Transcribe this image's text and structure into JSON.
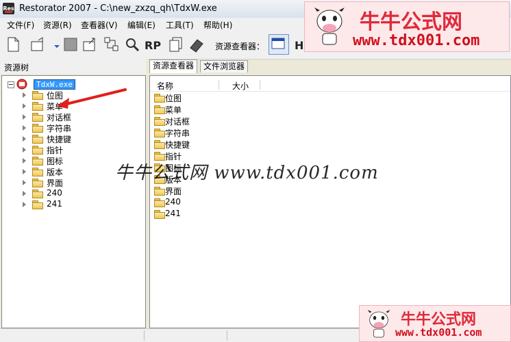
{
  "window": {
    "title": "Restorator 2007 - C:\\new_zxzq_qh\\TdxW.exe",
    "app_icon_text": "Res"
  },
  "menu": [
    {
      "label": "文件(F)"
    },
    {
      "label": "资源(R)"
    },
    {
      "label": "查看器(V)"
    },
    {
      "label": "编辑(E)"
    },
    {
      "label": "工具(T)"
    },
    {
      "label": "帮助(H)"
    }
  ],
  "toolbar": {
    "viewer_label": "资源查看器："
  },
  "left_panel": {
    "header": "资源树",
    "root": "TdxW.exe",
    "items": [
      "位图",
      "菜单",
      "对话框",
      "字符串",
      "快捷键",
      "指针",
      "图标",
      "版本",
      "界面",
      "240",
      "241"
    ]
  },
  "right_panel": {
    "tabs": [
      {
        "label": "资源查看器",
        "active": true
      },
      {
        "label": "文件浏览器",
        "active": false
      }
    ],
    "columns": [
      "名称",
      "大小"
    ],
    "items": [
      "位图",
      "菜单",
      "对话框",
      "字符串",
      "快捷键",
      "指针",
      "图标",
      "版本",
      "界面",
      "240",
      "241"
    ]
  },
  "watermark": {
    "brand": "牛牛公式网",
    "url": "www.tdx001.com",
    "overlay": "牛牛公式网 www.tdx001.com"
  },
  "colors": {
    "accent_red": "#e02a3a",
    "selection": "#3399ff",
    "arrow": "#e0201c"
  }
}
